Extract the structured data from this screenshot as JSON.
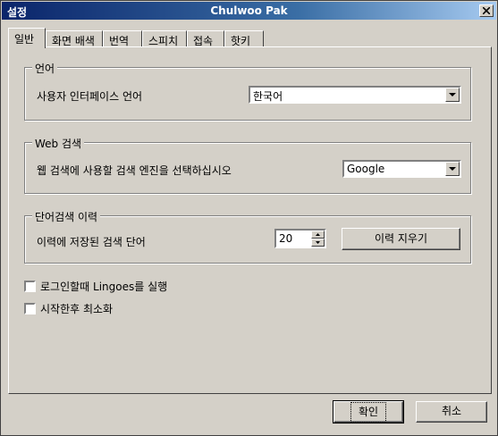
{
  "window": {
    "title_left": "설정",
    "title_center": "Chulwoo Pak",
    "close_icon": "close-icon"
  },
  "tabs": [
    {
      "label": "일반",
      "active": true
    },
    {
      "label": "화면 배색"
    },
    {
      "label": "번역"
    },
    {
      "label": "스피치"
    },
    {
      "label": "접속"
    },
    {
      "label": "핫키"
    }
  ],
  "language_group": {
    "legend": "언어",
    "ui_language_label": "사용자 인터페이스 언어",
    "ui_language_value": "한국어"
  },
  "web_search_group": {
    "legend": "Web 검색",
    "engine_label": "웹 검색에 사용할 검색 엔진을 선택하십시오",
    "engine_value": "Google"
  },
  "history_group": {
    "legend": "단어검색 이력",
    "count_label": "이력에 저장된 검색 단어",
    "count_value": "20",
    "clear_button": "이력 지우기"
  },
  "options": {
    "run_on_login": {
      "label": "로그인할때 Lingoes를 실행",
      "checked": false
    },
    "minimize_on_start": {
      "label": "시작한후 최소화",
      "checked": false
    }
  },
  "buttons": {
    "ok": "확인",
    "cancel": "취소"
  }
}
